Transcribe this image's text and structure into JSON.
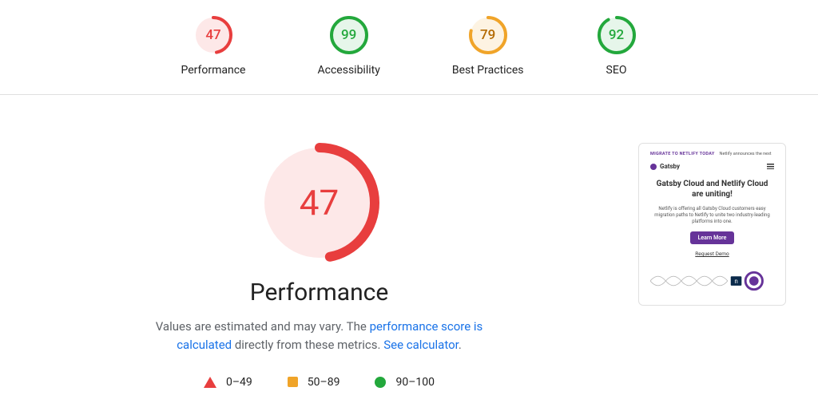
{
  "gauges": [
    {
      "score": 47,
      "label": "Performance",
      "tier": "red"
    },
    {
      "score": 99,
      "label": "Accessibility",
      "tier": "green"
    },
    {
      "score": 79,
      "label": "Best Practices",
      "tier": "orange"
    },
    {
      "score": 92,
      "label": "SEO",
      "tier": "green"
    }
  ],
  "performance": {
    "big_score": 47,
    "big_tier": "red",
    "title": "Performance",
    "desc_prefix": "Values are estimated and may vary. The ",
    "desc_link1": "performance score is calculated",
    "desc_mid": " directly from these metrics. ",
    "desc_link2": "See calculator",
    "desc_suffix": "."
  },
  "legend": [
    {
      "shape": "tri",
      "range": "0–49"
    },
    {
      "shape": "sq",
      "range": "50–89"
    },
    {
      "shape": "dot",
      "range": "90–100"
    }
  ],
  "preview": {
    "banner_tag": "MIGRATE TO NETLIFY TODAY",
    "banner_text": "Netlify announces the next",
    "brand": "Gatsby",
    "headline": "Gatsby Cloud and Netlify Cloud are uniting!",
    "body": "Netlify is offering all Gatsby Cloud customers easy migration paths to Netlify to unite two industry-leading platforms into one.",
    "cta": "Learn More",
    "demo": "Request Demo"
  }
}
